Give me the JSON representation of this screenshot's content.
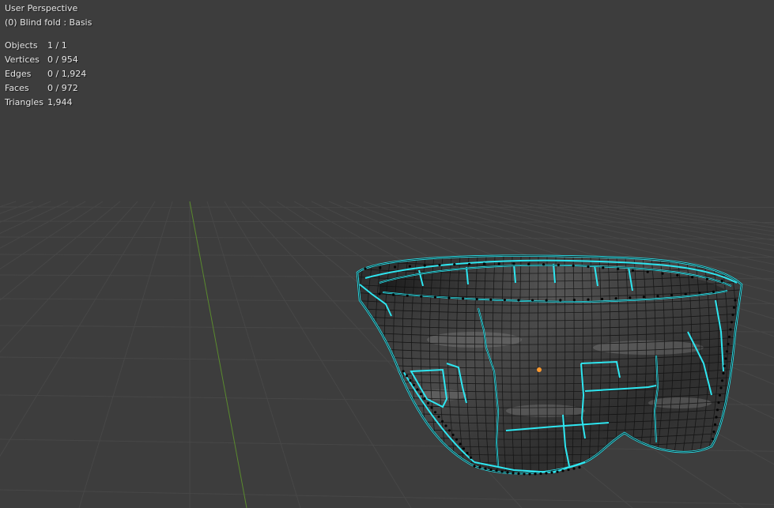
{
  "viewport": {
    "view_name": "User Perspective",
    "object_info": "(0) Blind fold : Basis"
  },
  "stats": [
    {
      "label": "Objects",
      "value": "1 / 1"
    },
    {
      "label": "Vertices",
      "value": "0 / 954"
    },
    {
      "label": "Edges",
      "value": "0 / 1,924"
    },
    {
      "label": "Faces",
      "value": "0 / 972"
    },
    {
      "label": "Triangles",
      "value": "1,944"
    }
  ],
  "colors": {
    "background": "#3d3d3d",
    "grid_line": "#474747",
    "y_axis": "#5a8a2e",
    "seam": "#2ee6f0",
    "mesh_wire": "#101010",
    "origin": "#ff9a2e",
    "text": "#e6e6e6"
  }
}
